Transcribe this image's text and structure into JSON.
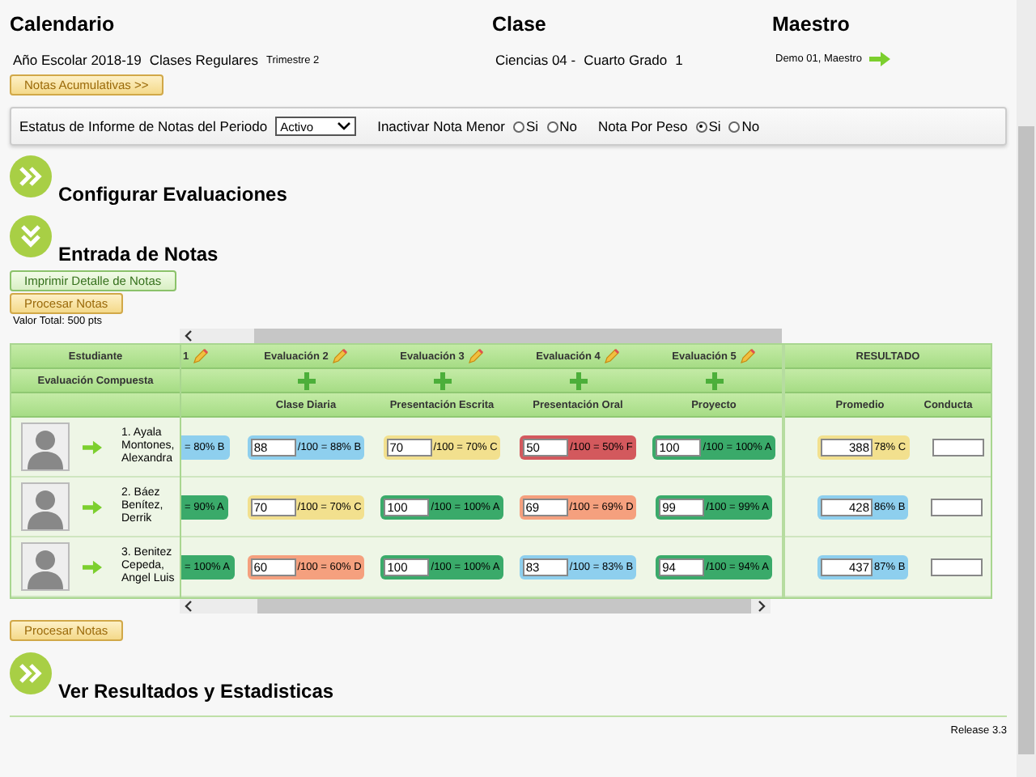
{
  "calendar": {
    "title": "Calendario",
    "year": "Año Escolar 2018-19",
    "type": "Clases Regulares",
    "term": "Trimestre 2",
    "button": "Notas Acumulativas >>"
  },
  "class": {
    "title": "Clase",
    "name": "Ciencias 04 -",
    "grade": "Cuarto Grado",
    "section": "1"
  },
  "teacher": {
    "title": "Maestro",
    "name": "Demo 01, Maestro"
  },
  "filters": {
    "status_label": "Estatus de Informe de Notas del Periodo",
    "status_value": "Activo",
    "groups": [
      {
        "label": "Inactivar Nota Menor",
        "options": [
          {
            "label": "Si",
            "selected": false
          },
          {
            "label": "No",
            "selected": false
          }
        ]
      },
      {
        "label": "Nota Por Peso",
        "options": [
          {
            "label": "Si",
            "selected": true
          },
          {
            "label": "No",
            "selected": false
          }
        ]
      }
    ]
  },
  "sections": [
    {
      "title": "Configurar Evaluaciones",
      "expanded": false
    },
    {
      "title": "Entrada de Notas",
      "expanded": true
    }
  ],
  "grades": {
    "print_button": "Imprimir Detalle de Notas",
    "process_button": "Procesar Notas",
    "total": "Valor Total: 500 pts",
    "student_header": "Estudiante",
    "composite_label": "Evaluación Compuesta",
    "evaluations": [
      {
        "kind": "partial",
        "title": "1"
      },
      {
        "kind": "full",
        "title": "Evaluación 2",
        "category": "Clase Diaria"
      },
      {
        "kind": "full",
        "title": "Evaluación 3",
        "category": "Presentación Escrita"
      },
      {
        "kind": "full",
        "title": "Evaluación 4",
        "category": "Presentación Oral"
      },
      {
        "kind": "full",
        "title": "Evaluación 5",
        "category": "Proyecto"
      }
    ],
    "result_header": "RESULTADO",
    "result_columns": [
      "Promedio",
      "Conducta"
    ],
    "students": [
      {
        "name": "1. Ayala Montones, Alexandra",
        "scores": [
          {
            "text": "= 80% B",
            "color": "#8ecfee"
          },
          {
            "value": "88",
            "text": "/100 = 88% B",
            "color": "#8ecfee"
          },
          {
            "value": "70",
            "text": "/100 = 70% C",
            "color": "#f2e08e"
          },
          {
            "value": "50",
            "text": "/100 = 50% F",
            "color": "#d3595d"
          },
          {
            "value": "100",
            "text": "/100 = 100% A",
            "color": "#3aaa6a"
          }
        ],
        "average": {
          "value": "388",
          "text": "78% C",
          "color": "#f2e08e"
        }
      },
      {
        "name": "2. Báez Benítez, Derrik",
        "scores": [
          {
            "text": "= 90% A",
            "color": "#3aaa6a"
          },
          {
            "value": "70",
            "text": "/100 = 70% C",
            "color": "#f2e08e"
          },
          {
            "value": "100",
            "text": "/100 = 100% A",
            "color": "#3aaa6a"
          },
          {
            "value": "69",
            "text": "/100 = 69% D",
            "color": "#f5a07e"
          },
          {
            "value": "99",
            "text": "/100 = 99% A",
            "color": "#3aaa6a"
          }
        ],
        "average": {
          "value": "428",
          "text": "86% B",
          "color": "#8ecfee"
        }
      },
      {
        "name": "3. Benitez Cepeda, Angel Luis",
        "scores": [
          {
            "text": "= 100% A",
            "color": "#3aaa6a"
          },
          {
            "value": "60",
            "text": "/100 = 60% D",
            "color": "#f5a07e"
          },
          {
            "value": "100",
            "text": "/100 = 100% A",
            "color": "#3aaa6a"
          },
          {
            "value": "83",
            "text": "/100 = 83% B",
            "color": "#8ecfee"
          },
          {
            "value": "94",
            "text": "/100 = 94% A",
            "color": "#3aaa6a"
          }
        ],
        "average": {
          "value": "437",
          "text": "87% B",
          "color": "#8ecfee"
        }
      }
    ],
    "bottom_button": "Procesar Notas"
  },
  "final_section": {
    "title": "Ver Resultados y Estadisticas",
    "expanded": false
  },
  "release": "Release 3.3"
}
